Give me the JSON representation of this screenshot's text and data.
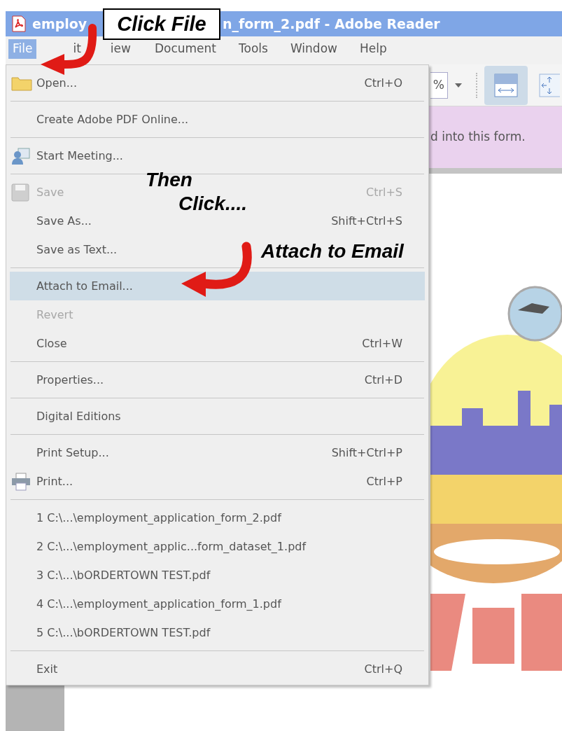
{
  "window": {
    "title_parts": [
      "employ",
      "n_form_2.pdf - Adobe Reader"
    ]
  },
  "menu_bar": [
    {
      "label": "File",
      "selected": true
    },
    {
      "label": "it",
      "selected": false
    },
    {
      "label": "iew",
      "selected": false
    },
    {
      "label": "Document",
      "selected": false
    },
    {
      "label": "Tools",
      "selected": false
    },
    {
      "label": "Window",
      "selected": false
    },
    {
      "label": "Help",
      "selected": false
    }
  ],
  "toolbar": {
    "zoom_fragment": "%",
    "fit_width_selected": true
  },
  "message_bar": {
    "text": "d into this form."
  },
  "file_menu": [
    {
      "kind": "item",
      "label": "Open...",
      "shortcut": "Ctrl+O",
      "disabled": false,
      "selected": false
    },
    {
      "kind": "separator"
    },
    {
      "kind": "item",
      "label": "Create Adobe PDF Online...",
      "disabled": false,
      "selected": false
    },
    {
      "kind": "separator"
    },
    {
      "kind": "item",
      "label": "Start Meeting...",
      "disabled": false,
      "selected": false
    },
    {
      "kind": "separator"
    },
    {
      "kind": "item",
      "label": "Save",
      "shortcut": "Ctrl+S",
      "disabled": true,
      "selected": false
    },
    {
      "kind": "item",
      "label": "Save As...",
      "shortcut": "Shift+Ctrl+S",
      "disabled": false,
      "selected": false
    },
    {
      "kind": "item",
      "label": "Save as Text...",
      "disabled": false,
      "selected": false
    },
    {
      "kind": "separator"
    },
    {
      "kind": "item",
      "label": "Attach to Email...",
      "disabled": false,
      "selected": true
    },
    {
      "kind": "item",
      "label": "Revert",
      "disabled": true,
      "selected": false
    },
    {
      "kind": "item",
      "label": "Close",
      "shortcut": "Ctrl+W",
      "disabled": false,
      "selected": false
    },
    {
      "kind": "separator"
    },
    {
      "kind": "item",
      "label": "Properties...",
      "shortcut": "Ctrl+D",
      "disabled": false,
      "selected": false
    },
    {
      "kind": "separator"
    },
    {
      "kind": "item",
      "label": "Digital Editions",
      "disabled": false,
      "selected": false
    },
    {
      "kind": "separator"
    },
    {
      "kind": "item",
      "label": "Print Setup...",
      "shortcut": "Shift+Ctrl+P",
      "disabled": false,
      "selected": false
    },
    {
      "kind": "item",
      "label": "Print...",
      "shortcut": "Ctrl+P",
      "disabled": false,
      "selected": false
    },
    {
      "kind": "separator"
    },
    {
      "kind": "item",
      "label": "1 C:\\...\\employment_application_form_2.pdf",
      "disabled": false,
      "selected": false
    },
    {
      "kind": "item",
      "label": "2 C:\\...\\employment_applic...form_dataset_1.pdf",
      "disabled": false,
      "selected": false
    },
    {
      "kind": "item",
      "label": "3 C:\\...\\bORDERTOWN TEST.pdf",
      "disabled": false,
      "selected": false
    },
    {
      "kind": "item",
      "label": "4 C:\\...\\employment_application_form_1.pdf",
      "disabled": false,
      "selected": false
    },
    {
      "kind": "item",
      "label": "5 C:\\...\\bORDERTOWN TEST.pdf",
      "disabled": false,
      "selected": false
    },
    {
      "kind": "separator"
    },
    {
      "kind": "item",
      "label": "Exit",
      "shortcut": "Ctrl+Q",
      "disabled": false,
      "selected": false
    }
  ],
  "annotations": [
    {
      "kind": "callout",
      "text": "Click File"
    },
    {
      "kind": "label",
      "text": "Then"
    },
    {
      "kind": "label",
      "text": "Click...."
    },
    {
      "kind": "label",
      "text": "Attach to Email"
    }
  ]
}
